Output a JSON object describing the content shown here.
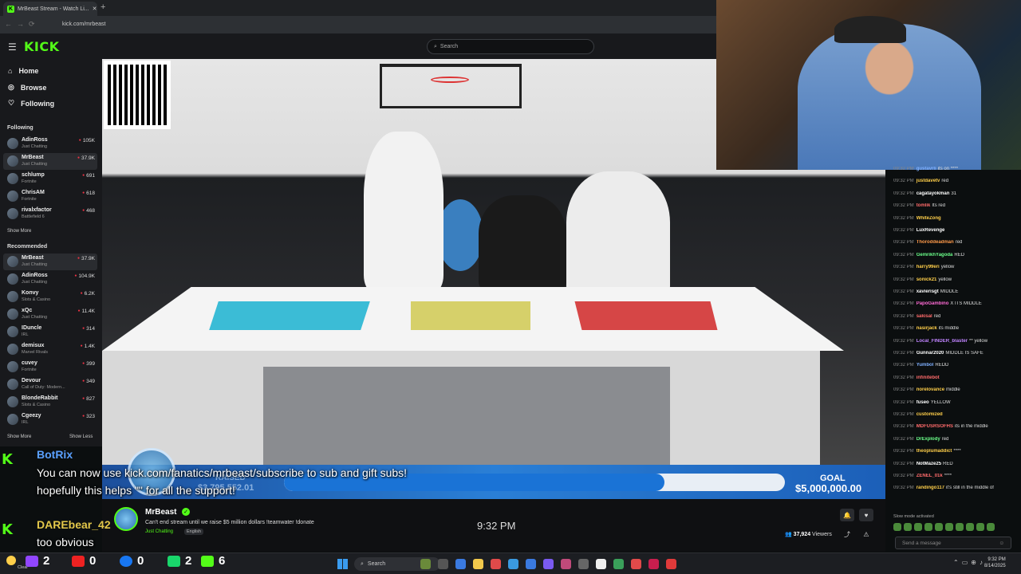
{
  "browser": {
    "tab_title": "MrBeast Stream - Watch Li...",
    "tab_close": "✕",
    "new_tab": "+",
    "url": "kick.com/mrbeast"
  },
  "header": {
    "logo": "KICK",
    "search_placeholder": "Search"
  },
  "sidebar": {
    "nav": [
      {
        "label": "Home",
        "icon": "home-icon"
      },
      {
        "label": "Browse",
        "icon": "compass-icon"
      },
      {
        "label": "Following",
        "icon": "heart-icon"
      }
    ],
    "following_title": "Following",
    "following": [
      {
        "name": "AdinRoss",
        "category": "Just Chatting",
        "viewers": "105K"
      },
      {
        "name": "MrBeast",
        "category": "Just Chatting",
        "viewers": "37.9K",
        "active": true
      },
      {
        "name": "schlump",
        "category": "Fortnite",
        "viewers": "691"
      },
      {
        "name": "ChrisAM",
        "category": "Fortnite",
        "viewers": "618"
      },
      {
        "name": "rivalxfactor",
        "category": "Battlefield 6",
        "viewers": "468"
      }
    ],
    "show_more": "Show More",
    "recommended_title": "Recommended",
    "recommended": [
      {
        "name": "MrBeast",
        "category": "Just Chatting",
        "viewers": "37.9K",
        "active": true
      },
      {
        "name": "AdinRoss",
        "category": "Just Chatting",
        "viewers": "104.9K"
      },
      {
        "name": "Konvy",
        "category": "Slots & Casino",
        "viewers": "6.2K"
      },
      {
        "name": "xQc",
        "category": "Just Chatting",
        "viewers": "11.4K"
      },
      {
        "name": "IDuncle",
        "category": "IRL",
        "viewers": "314"
      },
      {
        "name": "demisux",
        "category": "Marvel Rivals",
        "viewers": "1.4K"
      },
      {
        "name": "cuvey",
        "category": "Fortnite",
        "viewers": "399"
      },
      {
        "name": "Devour",
        "category": "Call of Duty: Modern...",
        "viewers": "349"
      },
      {
        "name": "BlondeRabbit",
        "category": "Slots & Casino",
        "viewers": "827"
      },
      {
        "name": "Cgeezy",
        "category": "IRL",
        "viewers": "323"
      }
    ],
    "show_more_2": "Show More",
    "show_less": "Show Less"
  },
  "donation": {
    "raised_label": "RAISED",
    "raised_value": "$3,795,552.01",
    "goal_label": "GOAL",
    "goal_value": "$5,000,000.00",
    "progress_fraction": 0.76
  },
  "overlay": {
    "msg1_user": "BotRix",
    "msg1_line1": "You can now use kick.com/fanatics/mrbeast/subscribe to sub and gift subs!",
    "msg1_line2": "hopefully this helps \"\" for all the support!",
    "msg2_user": "DAREbear_42",
    "msg2_line1": "too obvious",
    "time": "9:32 PM"
  },
  "stream": {
    "channel": "MrBeast",
    "title": "Can't end stream until we raise $5 million dollars !teamwater !donate",
    "category": "Just Chatting",
    "language": "English",
    "viewers": "37,924",
    "viewers_label": "Viewers"
  },
  "chat": {
    "messages": [
      {
        "time": "09:32 PM",
        "user": "gustavrli",
        "color": "#7fb0ff",
        "text": "its on ****"
      },
      {
        "time": "09:32 PM",
        "user": "justdavetv",
        "color": "#ffcf4a",
        "text": "red"
      },
      {
        "time": "09:32 PM",
        "user": "cagatayokman",
        "color": "#ffffff",
        "text": "31"
      },
      {
        "time": "09:32 PM",
        "user": "tomlik",
        "color": "#ff6b6b",
        "text": "Its red"
      },
      {
        "time": "09:32 PM",
        "user": "WhiteZong",
        "color": "#ffcf4a",
        "text": ""
      },
      {
        "time": "09:32 PM",
        "user": "LuxRevenge",
        "color": "#ffffff",
        "text": ""
      },
      {
        "time": "09:32 PM",
        "user": "Thoroddeadman",
        "color": "#ff9a4a",
        "text": "red"
      },
      {
        "time": "09:32 PM",
        "user": "GemrikhYagoda",
        "color": "#6bff8a",
        "text": "RED"
      },
      {
        "time": "09:32 PM",
        "user": "harry99eri",
        "color": "#ffcf4a",
        "text": "yellow"
      },
      {
        "time": "09:32 PM",
        "user": "sonick21",
        "color": "#ffcf4a",
        "text": "yellow"
      },
      {
        "time": "09:32 PM",
        "user": "xavierisgt",
        "color": "#ffffff",
        "text": "MIDDLE"
      },
      {
        "time": "09:32 PM",
        "user": "PapoGambino",
        "color": "#ff6bd6",
        "text": "X ITS MIDDLE"
      },
      {
        "time": "09:32 PM",
        "user": "sakisal",
        "color": "#ff6b6b",
        "text": "red"
      },
      {
        "time": "09:32 PM",
        "user": "nasirjack",
        "color": "#ffcf4a",
        "text": "its middle"
      },
      {
        "time": "09:32 PM",
        "user": "Local_FINDER_blaster",
        "color": "#c084ff",
        "text": "** yellow"
      },
      {
        "time": "09:32 PM",
        "user": "Gunnar2020",
        "color": "#ffffff",
        "text": "MIDDLE IS SAFE"
      },
      {
        "time": "09:32 PM",
        "user": "Yumbol",
        "color": "#7fb0ff",
        "text": "REDD"
      },
      {
        "time": "09:32 PM",
        "user": "infinitebot",
        "color": "#ff6b6b",
        "text": ""
      },
      {
        "time": "09:32 PM",
        "user": "norelovance",
        "color": "#ffcf4a",
        "text": "middle"
      },
      {
        "time": "09:32 PM",
        "user": "fuseo",
        "color": "#ffffff",
        "text": "YELLOW"
      },
      {
        "time": "09:32 PM",
        "user": "customized",
        "color": "#ffcf4a",
        "text": ""
      },
      {
        "time": "09:32 PM",
        "user": "MDFUSRSOFHS",
        "color": "#ff6b6b",
        "text": "its in the middle"
      },
      {
        "time": "09:32 PM",
        "user": "DrExplody",
        "color": "#6bff8a",
        "text": "red"
      },
      {
        "time": "09:32 PM",
        "user": "theoplumaddict",
        "color": "#ffcf4a",
        "text": "****"
      },
      {
        "time": "09:32 PM",
        "user": "NotMaze25",
        "color": "#ffffff",
        "text": "RED"
      },
      {
        "time": "09:32 PM",
        "user": "ZENEL_01k",
        "color": "#ff6b6b",
        "text": "****"
      },
      {
        "time": "09:32 PM",
        "user": "randingo117",
        "color": "#ffcf4a",
        "text": "it's still in the middle of"
      }
    ],
    "slow_mode": "Slow mode activated",
    "send_placeholder": "Send a message"
  },
  "taskbar": {
    "weather": "Clear",
    "stat_twitch": "2",
    "stat_youtube": "0",
    "stat_facebook": "0",
    "stat_trovo": "2",
    "stat_kick": "6",
    "search": "Search",
    "time": "9:32 PM",
    "date": "8/14/2025"
  }
}
